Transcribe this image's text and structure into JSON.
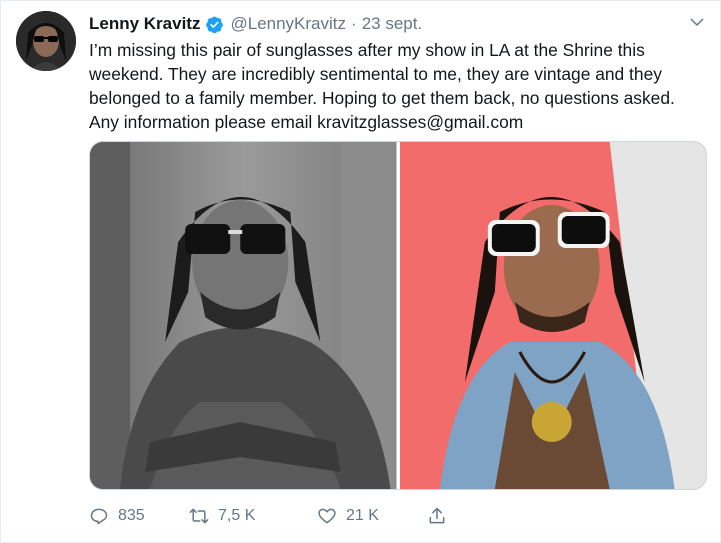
{
  "tweet": {
    "author_name": "Lenny Kravitz",
    "handle": "@LennyKravitz",
    "separator": "·",
    "date": "23 sept.",
    "text": "I’m missing this pair of sunglasses after my show in LA at the Shrine this\nweekend. They are incredibly sentimental to me, they are vintage and they\nbelonged to a family member. Hoping to get them back, no questions asked.\nAny information please email kravitzglasses@gmail.com",
    "verified": true
  },
  "actions": {
    "reply_count": "835",
    "retweet_count": "7,5 K",
    "like_count": "21 K"
  },
  "colors": {
    "verified_blue": "#1da1f2",
    "muted_text": "#657786",
    "primary_text": "#14171a",
    "photo_right_bg": "#f26c6c"
  },
  "icons": [
    "verified-badge-icon",
    "chevron-down-icon",
    "reply-icon",
    "retweet-icon",
    "like-icon",
    "share-icon"
  ]
}
